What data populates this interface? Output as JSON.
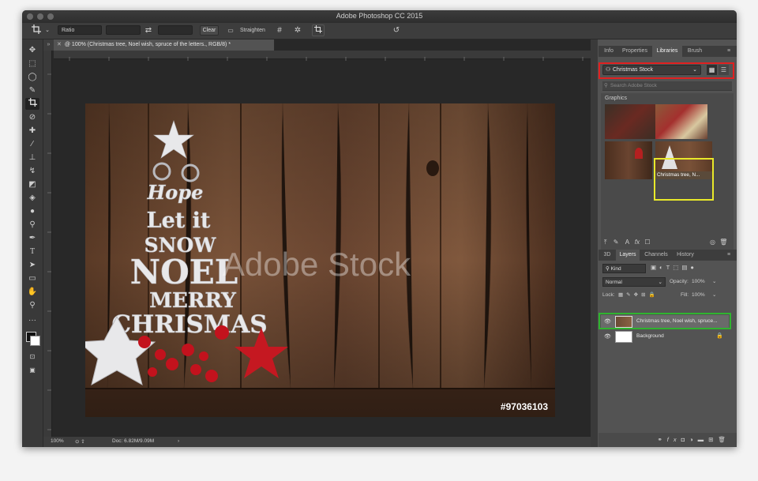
{
  "window": {
    "title": "Adobe Photoshop CC 2015"
  },
  "options_bar": {
    "crop_tool_icon": "crop-icon",
    "ratio_label": "Ratio",
    "swap_icon": "swap-arrows-icon",
    "clear_label": "Clear",
    "straighten_label": "Straighten",
    "grid_icon": "grid-overlay-icon",
    "gear_icon": "gear-icon",
    "delete_cropped_icon": "crop-pixels-icon",
    "reset_icon": "undo-icon"
  },
  "document": {
    "tab_label": "@ 100% (Christmas tree, Noel wish, spruce of the letters., RGB/8) *",
    "watermark": "Adobe Stock",
    "stock_id": "#97036103",
    "zoom": "100%",
    "doc_size": "Doc: 6.82M/9.09M"
  },
  "tools": [
    "move-tool-icon",
    "marquee-tool-icon",
    "lasso-tool-icon",
    "quick-select-icon",
    "crop-tool-icon",
    "eyedropper-icon",
    "healing-brush-icon",
    "brush-icon",
    "clone-stamp-icon",
    "history-brush-icon",
    "eraser-icon",
    "paint-bucket-icon",
    "blur-icon",
    "dodge-icon",
    "pen-icon",
    "type-icon",
    "path-select-icon",
    "rectangle-icon",
    "hand-icon",
    "zoom-icon",
    "more-tools-icon",
    "color-swatch-icon",
    "quick-mask-icon",
    "screen-mode-icon"
  ],
  "libraries_panel": {
    "tabs": [
      "Info",
      "Properties",
      "Libraries",
      "Brush"
    ],
    "active_tab": "Libraries",
    "library_name": "Christmas Stock",
    "search_placeholder": "Search Adobe Stock",
    "section": "Graphics",
    "selected_thumb_label": "Christmas tree, N..."
  },
  "layers_panel": {
    "tabs": [
      "3D",
      "Layers",
      "Channels",
      "History"
    ],
    "active_tab": "Layers",
    "filter_kind": "Kind",
    "blend_mode": "Normal",
    "opacity_label": "Opacity:",
    "opacity_value": "100%",
    "lock_label": "Lock:",
    "fill_label": "Fill:",
    "fill_value": "100%",
    "layers": [
      {
        "name": "Christmas tree, Noel wish, spruce..."
      },
      {
        "name": "Background"
      }
    ]
  },
  "colors": {
    "highlight_red": "#e02020",
    "highlight_green": "#2fb42f",
    "highlight_yellow": "#e8e82a"
  }
}
